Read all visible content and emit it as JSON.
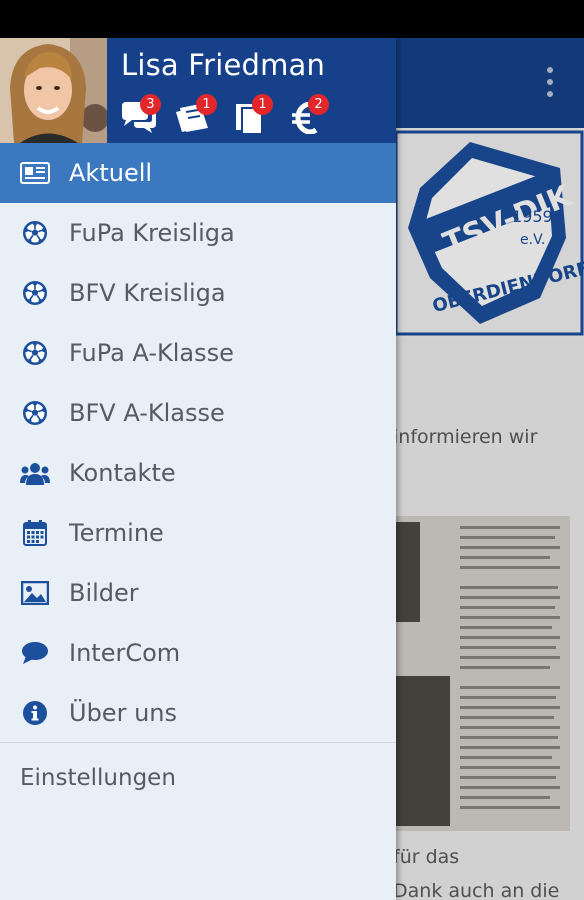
{
  "user": {
    "name": "Lisa Friedman"
  },
  "badges": {
    "messages": "3",
    "matches": "1",
    "documents": "1",
    "payments": "2"
  },
  "nav": {
    "items": [
      {
        "label": "Aktuell",
        "icon": "newspaper-icon",
        "active": true
      },
      {
        "label": "FuPa Kreisliga",
        "icon": "soccer-ball-icon",
        "active": false
      },
      {
        "label": "BFV Kreisliga",
        "icon": "soccer-ball-icon",
        "active": false
      },
      {
        "label": "FuPa A-Klasse",
        "icon": "soccer-ball-icon",
        "active": false
      },
      {
        "label": "BFV A-Klasse",
        "icon": "soccer-ball-icon",
        "active": false
      },
      {
        "label": "Kontakte",
        "icon": "people-icon",
        "active": false
      },
      {
        "label": "Termine",
        "icon": "calendar-icon",
        "active": false
      },
      {
        "label": "Bilder",
        "icon": "image-icon",
        "active": false
      },
      {
        "label": "InterCom",
        "icon": "chat-icon",
        "active": false
      },
      {
        "label": "Über uns",
        "icon": "info-icon",
        "active": false
      }
    ],
    "settings": "Einstellungen"
  },
  "background": {
    "logo": {
      "club": "TSV-DJK",
      "year": "1959",
      "suffix": "e.V.",
      "town": "OBERDIENDORF"
    },
    "text_1": "informieren wir",
    "text_2": "für das",
    "text_3": "Dank auch an die"
  },
  "colors": {
    "primary": "#16418a",
    "active": "#3b78c0",
    "drawer_bg": "#e8eff6",
    "icon": "#1c4f9c",
    "badge": "#e3262a"
  }
}
